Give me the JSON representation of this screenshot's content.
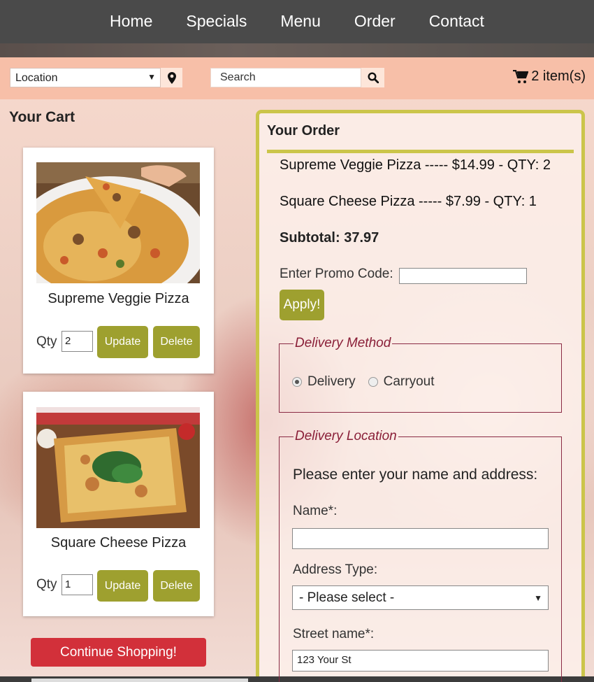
{
  "nav": {
    "items": [
      "Home",
      "Specials",
      "Menu",
      "Order",
      "Contact"
    ]
  },
  "toolbar": {
    "location_value": "Location",
    "location_icon": "map-marker-icon",
    "search_placeholder": "Search",
    "search_icon": "magnifier-icon",
    "cart_icon": "shopping-cart-icon",
    "cart_count": "2 item(s)"
  },
  "cart": {
    "heading": "Your Cart",
    "qty_label": "Qty",
    "update_label": "Update",
    "delete_label": "Delete",
    "items": [
      {
        "name": "Supreme Veggie Pizza",
        "qty": "2"
      },
      {
        "name": "Square Cheese Pizza",
        "qty": "1"
      }
    ],
    "continue_label": "Continue Shopping!"
  },
  "order": {
    "heading": "Your Order",
    "lines": [
      "Supreme Veggie Pizza ----- $14.99 - QTY: 2",
      "Square Cheese Pizza ----- $7.99 - QTY: 1"
    ],
    "subtotal": "Subtotal: 37.97",
    "promo_label": "Enter Promo Code:",
    "promo_value": "",
    "apply_label": "Apply!",
    "delivery_method": {
      "legend": "Delivery Method",
      "options": [
        "Delivery",
        "Carryout"
      ],
      "selected": "Delivery"
    },
    "delivery_location": {
      "legend": "Delivery Location",
      "prompt": "Please enter your name and address:",
      "name_label": "Name*:",
      "name_value": "",
      "address_type_label": "Address Type:",
      "address_type_value": "- Please select -",
      "street_label": "Street name*:",
      "street_value": "123 Your St"
    }
  },
  "colors": {
    "nav_bg": "#4a4a4a",
    "toolbar_bg": "#f7bfa8",
    "olive_button": "#9ea02f",
    "panel_border": "#cbc54a",
    "legend_color": "#8a1f38",
    "continue_button": "#d2303a"
  }
}
